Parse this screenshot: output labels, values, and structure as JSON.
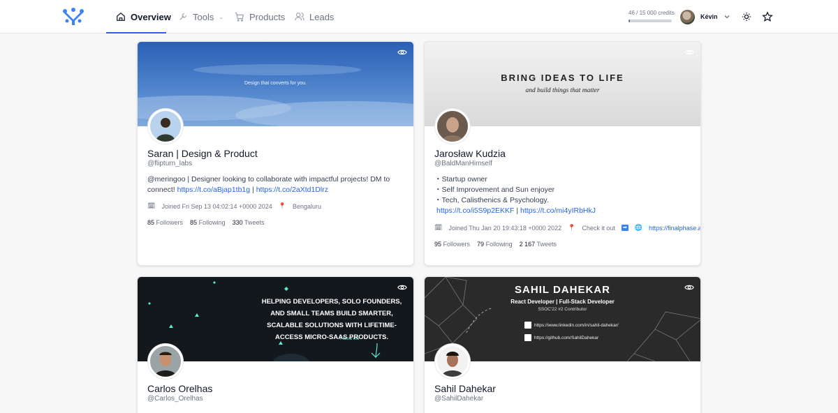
{
  "nav": {
    "items": [
      {
        "label": "Overview",
        "icon": "home-icon"
      },
      {
        "label": "Tools",
        "icon": "wrench-icon"
      },
      {
        "label": "Products",
        "icon": "cart-icon"
      },
      {
        "label": "Leads",
        "icon": "users-icon"
      }
    ],
    "credits": {
      "text": "46 / 15 000 credits",
      "used_fraction": 0.003
    },
    "user_name": "Kévin",
    "accent": "#2563eb"
  },
  "cards": [
    {
      "banner_text": "Design that converts for you.",
      "name": "Saran | Design & Product",
      "handle": "@flipturn_labs",
      "bio_text": "@meringoo | Designer looking to collaborate with impactful projects!  DM to connect! ",
      "bio_link1": "https://t.co/aBjap1tb1g",
      "bio_sep": " | ",
      "bio_link2": "https://t.co/2aXtd1Dlrz",
      "joined": "Joined Fri Sep 13 04:02:14 +0000 2024",
      "location": "Bengaluru",
      "followers": "85",
      "following": "85",
      "tweets": "330"
    },
    {
      "banner_title": "BRING IDEAS TO LIFE",
      "banner_sub": "and build things that matter",
      "name": "Jarosław Kudzia",
      "handle": "@BaldManHimself",
      "bio_lines": [
        "・Startup owner",
        "・Self Improvement and Sun enjoyer",
        "・Tech, Calisthenics & Psychology."
      ],
      "bio_link1": "https://t.co/i5S9p2EKKF",
      "bio_sep": " | ",
      "bio_link2": "https://t.co/mi4yIRbHkJ",
      "joined": "Joined Thu Jan 20 19:43:18 +0000 2022",
      "location": "Check it out",
      "website": "https://finalphase.app",
      "followers": "95",
      "following": "79",
      "tweets": "2 167"
    },
    {
      "banner_text": "HELPING DEVELOPERS, SOLO FOUNDERS, AND SMALL TEAMS BUILD SMARTER, SCALABLE SOLUTIONS WITH LIFETIME-ACCESS MICRO-SAAS PRODUCTS.",
      "banner_follow": "Follow me",
      "name": "Carlos Orelhas",
      "handle": "@Carlos_Orelhas"
    },
    {
      "banner_title": "SAHIL DAHEKAR",
      "banner_sub": "React Developer | Full-Stack Developer",
      "banner_sub2": "SSOC'22 #2 Contributor",
      "banner_link1": "https://www.linkedin.com/in/sahil-dahekar/",
      "banner_link2": "https://github.com/SahilDahekar",
      "name": "Sahil Dahekar",
      "handle": "@SahilDahekar"
    }
  ],
  "labels": {
    "followers": "Followers",
    "following": "Following",
    "tweets": "Tweets"
  }
}
